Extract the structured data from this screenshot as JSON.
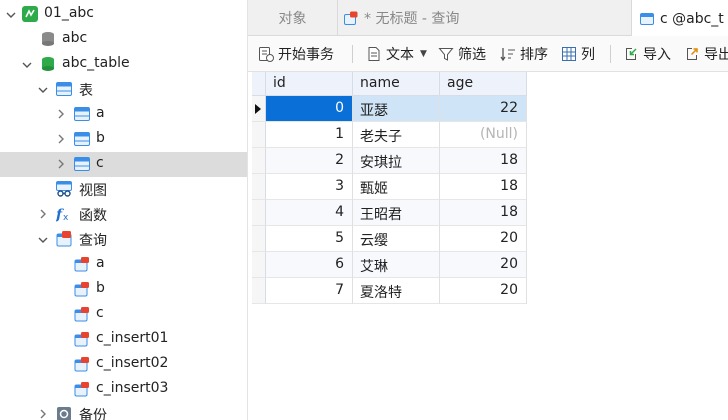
{
  "tree": {
    "nodes": [
      {
        "label": "01_abc",
        "icon": "connection-icon",
        "level": 0,
        "chevron": "down"
      },
      {
        "label": "abc",
        "icon": "database-gray-icon",
        "level": 1,
        "chevron": "none"
      },
      {
        "label": "abc_table",
        "icon": "database-green-icon",
        "level": 1,
        "chevron": "down"
      },
      {
        "label": "表",
        "icon": "tables-folder-icon",
        "level": 2,
        "chevron": "down"
      },
      {
        "label": "a",
        "icon": "table-icon",
        "level": 3,
        "chevron": "right"
      },
      {
        "label": "b",
        "icon": "table-icon",
        "level": 3,
        "chevron": "right"
      },
      {
        "label": "c",
        "icon": "table-icon",
        "level": 3,
        "chevron": "right",
        "selected": true
      },
      {
        "label": "视图",
        "icon": "view-icon",
        "level": 2,
        "chevron": "none"
      },
      {
        "label": "函数",
        "icon": "function-icon",
        "level": 2,
        "chevron": "right"
      },
      {
        "label": "查询",
        "icon": "query-folder-icon",
        "level": 2,
        "chevron": "down"
      },
      {
        "label": "a",
        "icon": "query-icon",
        "level": 3,
        "chevron": "none"
      },
      {
        "label": "b",
        "icon": "query-icon",
        "level": 3,
        "chevron": "none"
      },
      {
        "label": "c",
        "icon": "query-icon",
        "level": 3,
        "chevron": "none"
      },
      {
        "label": "c_insert01",
        "icon": "query-icon",
        "level": 3,
        "chevron": "none"
      },
      {
        "label": "c_insert02",
        "icon": "query-icon",
        "level": 3,
        "chevron": "none"
      },
      {
        "label": "c_insert03",
        "icon": "query-icon",
        "level": 3,
        "chevron": "none"
      },
      {
        "label": "备份",
        "icon": "backup-icon",
        "level": 2,
        "chevron": "right"
      }
    ]
  },
  "tabs": [
    {
      "label": "对象",
      "active": false
    },
    {
      "label": "* 无标题 - 查询",
      "active": false,
      "icon": "query-tab-icon"
    },
    {
      "label": "c @abc_t",
      "active": true,
      "icon": "table-tab-icon"
    }
  ],
  "toolbar": {
    "begin_transaction": "开始事务",
    "text": "文本",
    "filter": "筛选",
    "sort": "排序",
    "columns": "列",
    "import": "导入",
    "export": "导出"
  },
  "grid": {
    "columns": [
      "id",
      "name",
      "age"
    ],
    "rows": [
      {
        "id": "0",
        "name": "亚瑟",
        "age": "22"
      },
      {
        "id": "1",
        "name": "老夫子",
        "age": "(Null)"
      },
      {
        "id": "2",
        "name": "安琪拉",
        "age": "18"
      },
      {
        "id": "3",
        "name": "甄姬",
        "age": "18"
      },
      {
        "id": "4",
        "name": "王昭君",
        "age": "18"
      },
      {
        "id": "5",
        "name": "云缨",
        "age": "20"
      },
      {
        "id": "6",
        "name": "艾琳",
        "age": "20"
      },
      {
        "id": "7",
        "name": "夏洛特",
        "age": "20"
      }
    ],
    "selected_row": 0
  },
  "colors": {
    "selection": "#0a6fd6",
    "row_highlight": "#cfe4f7",
    "db_green": "#2eaa4a",
    "table_blue": "#3a8ee6"
  }
}
